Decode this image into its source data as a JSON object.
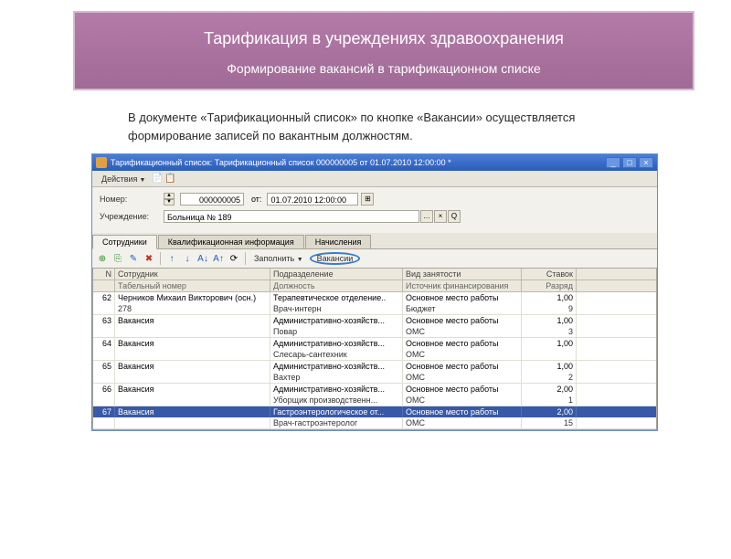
{
  "slide": {
    "title": "Тарификация в учреждениях здравоохранения",
    "subtitle": "Формирование вакансий в тарификационном списке",
    "body": "В документе «Тарификационный список» по кнопке «Вакансии» осуществляется формирование записей по вакантным должностям."
  },
  "window": {
    "title": "Тарификационный список: Тарификационный список 000000005 от 01.07.2010 12:00:00 *",
    "actions_label": "Действия",
    "form": {
      "number_label": "Номер:",
      "number_value": "000000005",
      "from_label": "от:",
      "date_value": "01.07.2010 12:00:00",
      "org_label": "Учреждение:",
      "org_value": "Больница № 189"
    },
    "tabs": [
      "Сотрудники",
      "Квалификационная информация",
      "Начисления"
    ],
    "active_tab": 0,
    "grid_toolbar": {
      "fill_label": "Заполнить",
      "vacancies_label": "Вакансии"
    },
    "grid": {
      "head": {
        "n": "N",
        "s": "Сотрудник",
        "p": "Подразделение",
        "v": "Вид занятости",
        "r": "Ставок"
      },
      "subhead": {
        "n": "",
        "s": "Табельный номер",
        "p": "Должность",
        "v": "Источник финансирования",
        "r": "Разряд"
      },
      "rows": [
        {
          "n": "62",
          "s": "Черников Михаил Викторович (осн.)",
          "s2": "278",
          "p": "Терапевтическое отделение..",
          "p2": "Врач-интерн",
          "v": "Основное место работы",
          "v2": "Бюджет",
          "r": "1,00",
          "r2": "9"
        },
        {
          "n": "63",
          "s": "Вакансия",
          "s2": "",
          "p": "Административно-хозяйств...",
          "p2": "Повар",
          "v": "Основное место работы",
          "v2": "ОМС",
          "r": "1,00",
          "r2": "3"
        },
        {
          "n": "64",
          "s": "Вакансия",
          "s2": "",
          "p": "Административно-хозяйств...",
          "p2": "Слесарь-сантехник",
          "v": "Основное место работы",
          "v2": "ОМС",
          "r": "1,00",
          "r2": ""
        },
        {
          "n": "65",
          "s": "Вакансия",
          "s2": "",
          "p": "Административно-хозяйств...",
          "p2": "Вахтер",
          "v": "Основное место работы",
          "v2": "ОМС",
          "r": "1,00",
          "r2": "2"
        },
        {
          "n": "66",
          "s": "Вакансия",
          "s2": "",
          "p": "Административно-хозяйств...",
          "p2": "Уборщик производственн...",
          "v": "Основное место работы",
          "v2": "ОМС",
          "r": "2,00",
          "r2": "1"
        },
        {
          "n": "67",
          "s": "Вакансия",
          "s2": "",
          "p": "Гастроэнтерологическое от...",
          "p2": "Врач-гастроэнтеролог",
          "v": "Основное место работы",
          "v2": "ОМС",
          "r": "2,00",
          "r2": "15"
        }
      ],
      "selected_index": 5
    }
  }
}
